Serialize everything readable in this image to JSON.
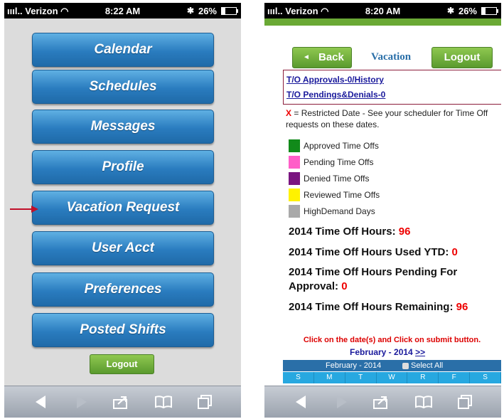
{
  "left_screen": {
    "status": {
      "carrier": "Verizon",
      "time": "8:22 AM",
      "battery": "26%"
    },
    "menu": [
      {
        "label": "Calendar"
      },
      {
        "label": "Schedules"
      },
      {
        "label": "Messages"
      },
      {
        "label": "Profile"
      },
      {
        "label": "Vacation Request"
      },
      {
        "label": "User Acct"
      },
      {
        "label": "Preferences"
      },
      {
        "label": "Posted Shifts"
      }
    ],
    "logout_label": "Logout"
  },
  "right_screen": {
    "status": {
      "carrier": "Verizon",
      "time": "8:20 AM",
      "battery": "26%"
    },
    "back_label": "Back",
    "title": "Vacation",
    "logout_label": "Logout",
    "links": [
      "T/O Approvals-0/History",
      "T/O Pendings&Denials-0"
    ],
    "note_x": "X",
    "note": " = Restricted Date - See your scheduler for Time Off requests on these dates.",
    "legend": [
      {
        "label": "Approved Time Offs",
        "color": "#118a1a"
      },
      {
        "label": "Pending Time Offs",
        "color": "#ff5ec8"
      },
      {
        "label": "Denied Time Offs",
        "color": "#7a1580"
      },
      {
        "label": "Reviewed Time Offs",
        "color": "#fff200"
      },
      {
        "label": "HighDemand Days",
        "color": "#a9a9a9"
      }
    ],
    "stats": {
      "hours_label": "2014 Time Off Hours:",
      "hours": "96",
      "used_label": "2014 Time Off Hours Used YTD:",
      "used": "0",
      "pending_label_1": "2014 Time Off Hours Pending For",
      "pending_label_2": "Approval:",
      "pending": "0",
      "remaining_label": "2014 Time Off Hours Remaining:",
      "remaining": "96"
    },
    "click_instruction": "Click on the date(s) and Click on submit button.",
    "month_nav": "February - 2014",
    "next_link": ">>",
    "calendar_month": "February - 2014",
    "select_all": "Select All",
    "days": [
      "S",
      "M",
      "T",
      "W",
      "R",
      "F",
      "S"
    ]
  }
}
